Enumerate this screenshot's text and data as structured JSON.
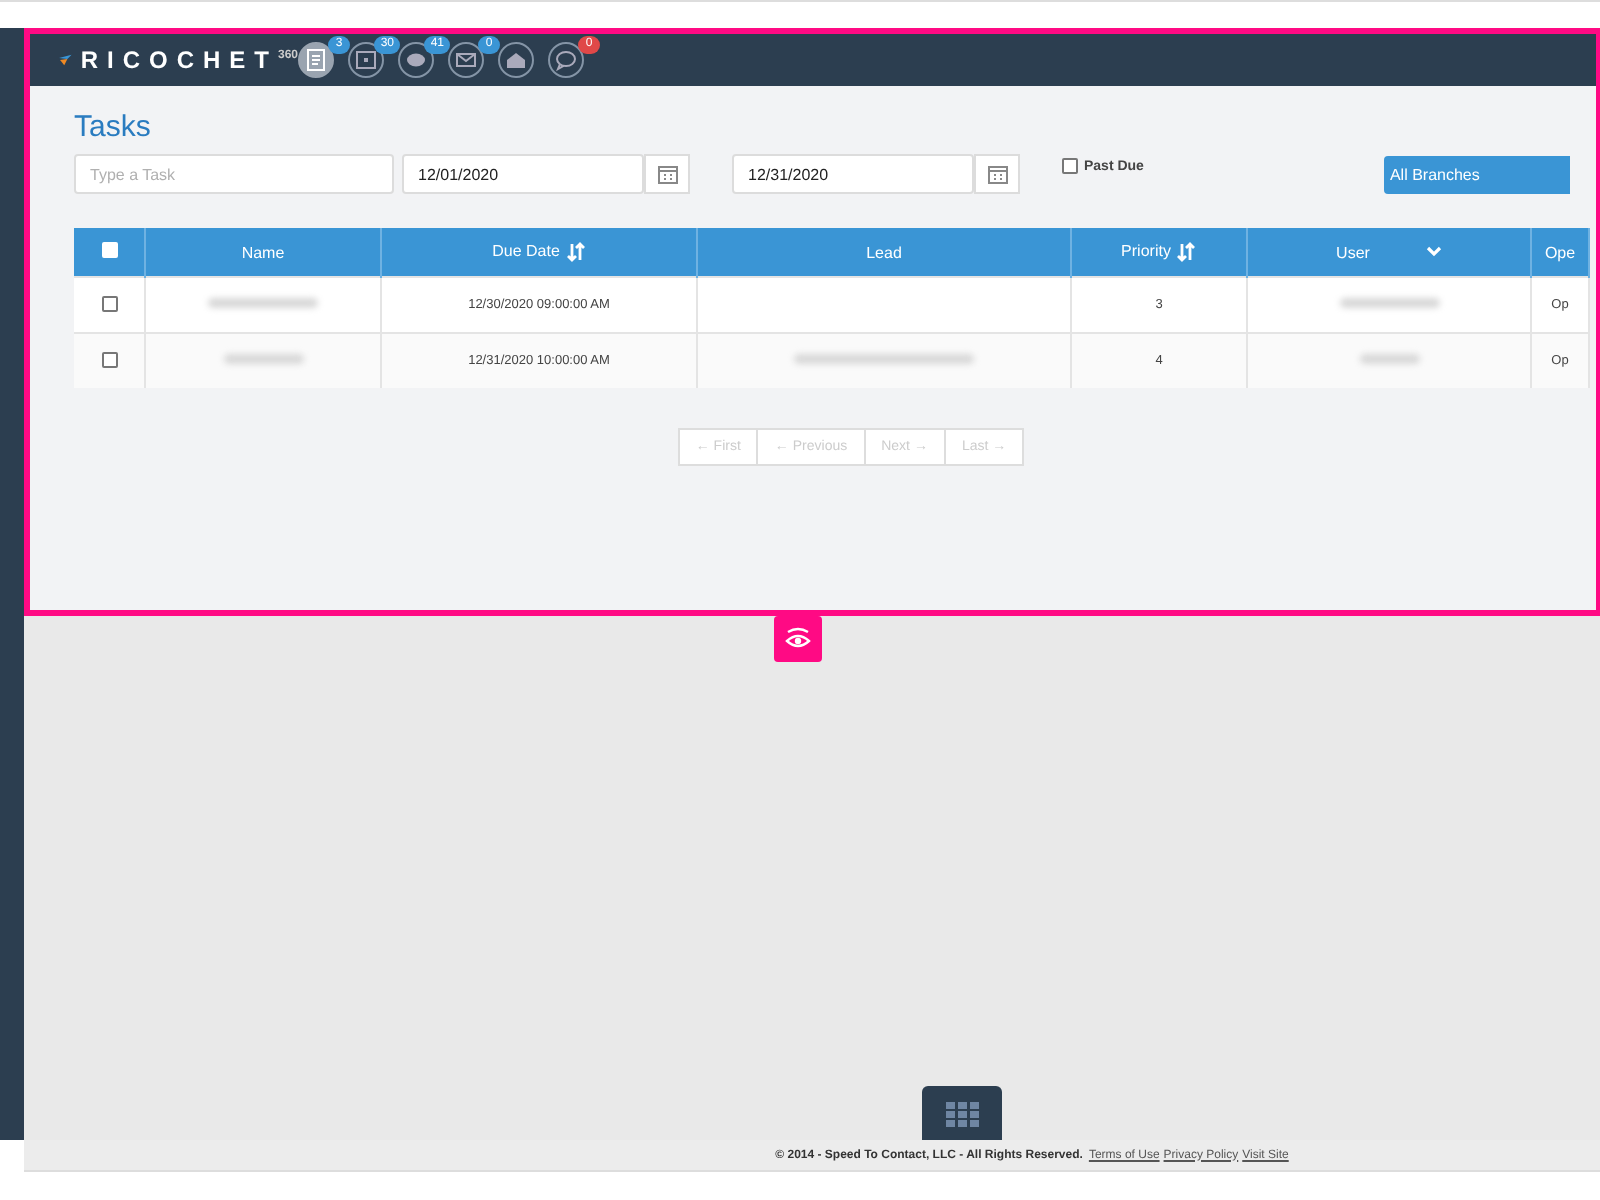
{
  "header": {
    "logo": "RICOCHET",
    "logo_sup": "360",
    "notifications": [
      {
        "kind": "doc",
        "badge": "3",
        "color": "#3a95d5",
        "active": true
      },
      {
        "kind": "calendar",
        "badge": "30",
        "color": "#3a95d5",
        "active": false
      },
      {
        "kind": "chat",
        "badge": "41",
        "color": "#3a95d5",
        "active": false
      },
      {
        "kind": "mail",
        "badge": "0",
        "color": "#3a95d5",
        "active": false
      },
      {
        "kind": "inbox",
        "active": false
      },
      {
        "kind": "bubble",
        "badge": "0",
        "color": "#e04848",
        "active": false
      }
    ]
  },
  "page": {
    "title": "Tasks"
  },
  "filters": {
    "task": {
      "placeholder": "Type a Task"
    },
    "start_date": "12/01/2020",
    "end_date": "12/31/2020",
    "past_due": {
      "label": "Past Due",
      "checked": false
    },
    "branch": "All Branches"
  },
  "table": {
    "select_all_checked": false,
    "columns": [
      {
        "label": "Name",
        "sort": false,
        "dropdown": false
      },
      {
        "label": "Due Date",
        "sort": true,
        "dropdown": false
      },
      {
        "label": "Lead",
        "sort": false,
        "dropdown": false
      },
      {
        "label": "Priority",
        "sort": true,
        "dropdown": false
      },
      {
        "label": "User",
        "sort": false,
        "dropdown": true
      },
      {
        "label": "Ope",
        "sort": false,
        "dropdown": false
      }
    ],
    "rows": [
      {
        "checked": false,
        "name_blurred": true,
        "due_date": "12/30/2020 09:00:00 AM",
        "lead_blurred": false,
        "priority": "3",
        "user_blurred": true,
        "column_6": "Op"
      },
      {
        "checked": false,
        "name_blurred": true,
        "due_date": "12/31/2020 10:00:00 AM",
        "lead_blurred": true,
        "priority": "4",
        "user_blurred": true,
        "column_6": "Op"
      }
    ]
  },
  "pagination": [
    {
      "label": "← First",
      "disabled": true
    },
    {
      "label": "← Previous",
      "disabled": true
    },
    {
      "label": "Next →",
      "disabled": true
    },
    {
      "label": "Last →",
      "disabled": true
    }
  ],
  "footer": {
    "text": "© 2014 - Speed To Contact, LLC - All Rights Reserved.",
    "links": [
      "Terms of Use",
      "Privacy Policy",
      "Visit Site"
    ]
  }
}
